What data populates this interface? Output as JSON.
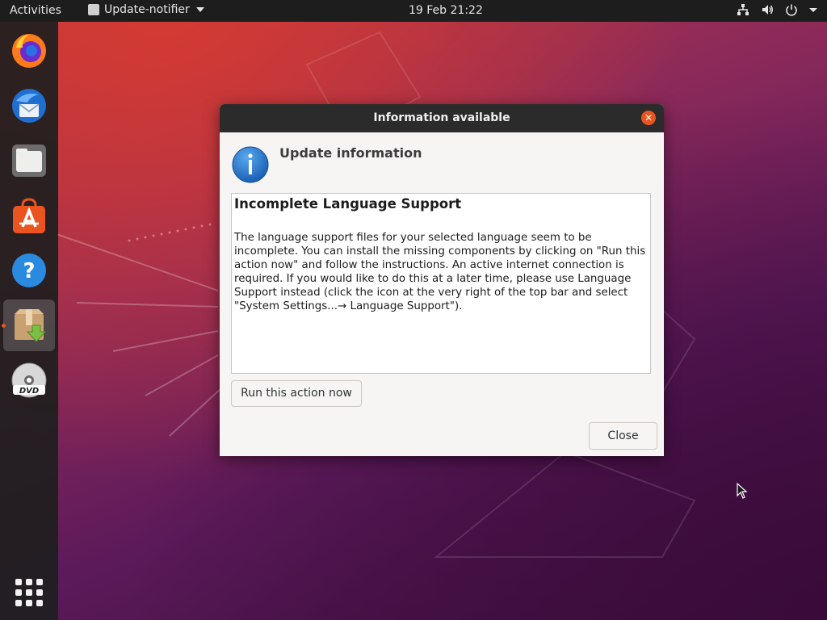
{
  "topbar": {
    "activities": "Activities",
    "app_menu": "Update-notifier",
    "clock": "19 Feb  21:22",
    "icons": [
      "network-icon",
      "volume-icon",
      "power-icon",
      "chevron-down-icon"
    ]
  },
  "dock": {
    "items": [
      {
        "name": "firefox-icon"
      },
      {
        "name": "thunderbird-icon"
      },
      {
        "name": "files-icon"
      },
      {
        "name": "software-center-icon"
      },
      {
        "name": "help-icon"
      },
      {
        "name": "update-notifier-icon",
        "active": true
      },
      {
        "name": "dvd-icon"
      }
    ],
    "show_apps": "show-apps-icon"
  },
  "dialog": {
    "title": "Information available",
    "heading": "Update information",
    "content_title": "Incomplete Language Support",
    "content_body": "The language support files for your selected language seem to be\nincomplete. You can install the missing components by clicking on \"Run this\naction now\" and follow the instructions. An active internet connection is\nrequired. If you would like to do this at a later time, please use Language\nSupport instead (click the icon at the very right of the top bar and select\n\"System Settings...→ Language Support\").",
    "run_button": "Run this action now",
    "close_button": "Close"
  },
  "colors": {
    "accent": "#e95420",
    "topbar": "#1d1d1d",
    "titlebar": "#2b2b2b"
  }
}
